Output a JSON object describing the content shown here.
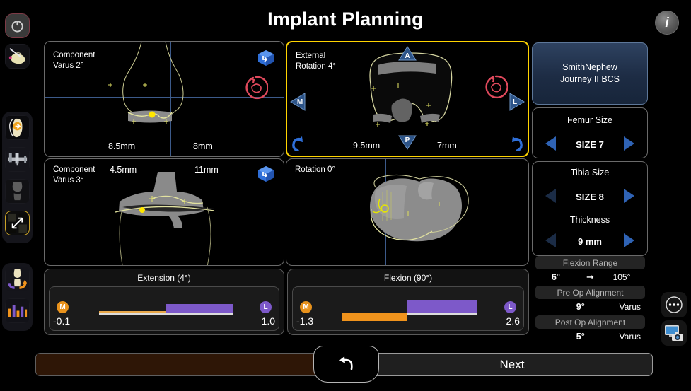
{
  "header": {
    "title": "Implant Planning",
    "info_icon": "info-icon",
    "info_label": "i"
  },
  "left_rail": {
    "power_icon": "power-icon",
    "items": [
      {
        "icon": "bone-probe-icon",
        "name": "bone-probe"
      },
      {
        "icon": "hip-navigation-icon",
        "name": "hip-navigation"
      },
      {
        "icon": "caliper-icon",
        "name": "caliper"
      },
      {
        "icon": "knee-xray-icon",
        "name": "knee-xray"
      },
      {
        "icon": "quad-view-expand-icon",
        "name": "quad-view-expand",
        "selected": true
      },
      {
        "icon": "knee-rotation-icon",
        "name": "knee-rotation"
      },
      {
        "icon": "bar-chart-icon",
        "name": "gap-chart"
      }
    ]
  },
  "viewports": [
    {
      "name": "femur-coronal",
      "label": "Component\nVarus 2°",
      "measure_left": "8.5mm",
      "measure_right": "8mm",
      "cube_icon": "3d-cube-icon",
      "reset_icon": "reset-view-icon",
      "active": false
    },
    {
      "name": "femur-axial",
      "label": "External\nRotation 4°",
      "measure_left": "9.5mm",
      "measure_right": "7mm",
      "marker_top": "A",
      "marker_bottom": "P",
      "marker_left": "M",
      "marker_right": "L",
      "reset_icon": "reset-view-icon",
      "active": true
    },
    {
      "name": "tibia-coronal",
      "label": "Component\nVarus 3°",
      "measure_left": "4.5mm",
      "measure_right": "11mm",
      "cube_icon": "3d-cube-icon",
      "active": false
    },
    {
      "name": "tibia-axial",
      "label": "Rotation 0°",
      "active": false
    }
  ],
  "gaps": [
    {
      "name": "extension-gap",
      "title": "Extension (4°)",
      "medial_badge": "M",
      "lateral_badge": "L",
      "medial_value": "-0.1",
      "lateral_value": "1.0",
      "medial_color": "#e8921c",
      "lateral_color": "#7d59c9",
      "medial_pct": -0.1,
      "lateral_pct": 1.0
    },
    {
      "name": "flexion-gap",
      "title": "Flexion (90°)",
      "medial_badge": "M",
      "lateral_badge": "L",
      "medial_value": "-1.3",
      "lateral_value": "2.6",
      "medial_color": "#e8921c",
      "lateral_color": "#7d59c9",
      "medial_pct": -1.3,
      "lateral_pct": 2.6
    }
  ],
  "sidebar": {
    "implant_line1": "SmithNephew",
    "implant_line2": "Journey II BCS",
    "femur_size_title": "Femur Size",
    "femur_size_value": "SIZE 7",
    "tibia_size_title": "Tibia Size",
    "tibia_size_value": "SIZE 8",
    "thickness_title": "Thickness",
    "thickness_value": "9 mm",
    "flexion_range_title": "Flexion Range",
    "flexion_min": "6°",
    "flexion_max": "105°",
    "preop_title": "Pre Op Alignment",
    "preop_value": "9°",
    "preop_type": "Varus",
    "postop_title": "Post Op Alignment",
    "postop_value": "5°",
    "postop_type": "Varus"
  },
  "float_buttons": [
    {
      "name": "more-options",
      "icon": "ellipsis-circle-icon"
    },
    {
      "name": "screenshot",
      "icon": "screen-capture-icon"
    }
  ],
  "footer": {
    "next_label": "Next",
    "back_icon": "back-arrow-icon",
    "progress_pct": 53,
    "progress_color": "#2e1606"
  },
  "colors": {
    "accent_yellow": "#ffd400",
    "blue_arrow": "#2f63b5",
    "blue_arrow_dim": "#1b2c46",
    "medial_orange": "#e8921c",
    "lateral_purple": "#7d59c9",
    "panel_border": "#6a6a6a"
  }
}
